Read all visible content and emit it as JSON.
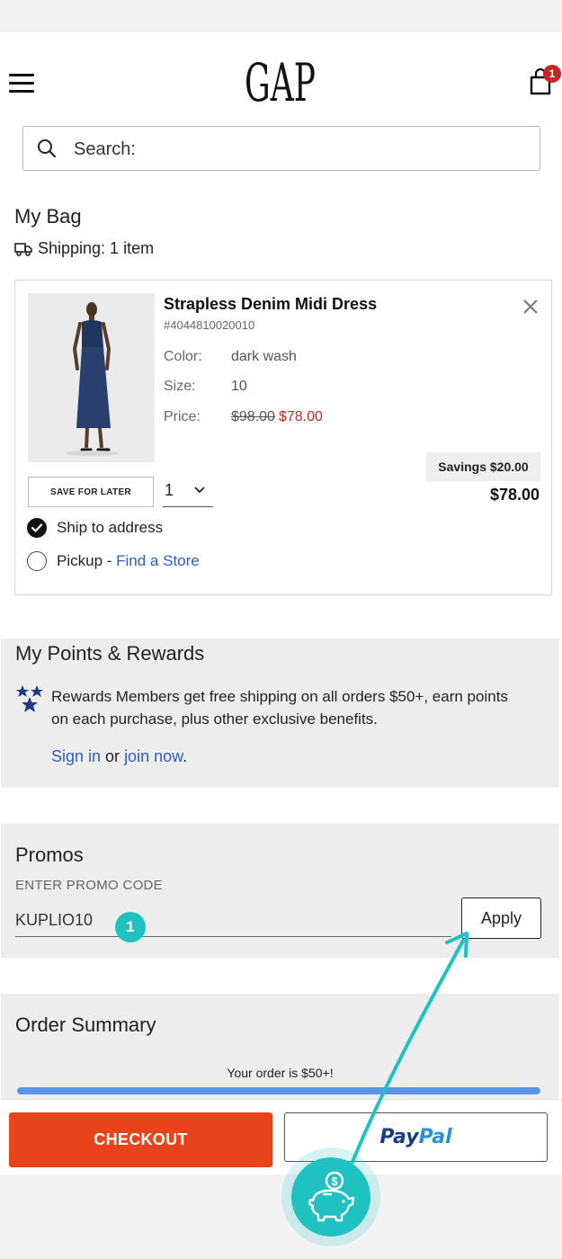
{
  "header": {
    "logo_text": "GAP",
    "bag_count": "1"
  },
  "search": {
    "placeholder": "Search:"
  },
  "bag": {
    "title": "My Bag",
    "shipping": "Shipping: 1 item"
  },
  "product": {
    "name": "Strapless Denim Midi Dress",
    "sku": "#4044810020010",
    "color_label": "Color:",
    "color_value": "dark wash",
    "size_label": "Size:",
    "size_value": "10",
    "price_label": "Price:",
    "price_original": "$98.00",
    "price_sale": "$78.00",
    "savings": "Savings $20.00",
    "total": "$78.00",
    "save_for_later": "SAVE FOR LATER",
    "quantity": "1",
    "ship_to_address": "Ship to address",
    "pickup": "Pickup - ",
    "find_store": "Find a Store"
  },
  "rewards": {
    "title": "My Points & Rewards",
    "text": "Rewards Members get free shipping on all orders $50+, earn points on each purchase, plus other exclusive benefits.",
    "sign_in": "Sign in",
    "or": " or ",
    "join_now": "join now",
    "period": "."
  },
  "promos": {
    "title": "Promos",
    "label": "ENTER PROMO CODE",
    "code": "KUPLIO10",
    "apply": "Apply",
    "step": "1"
  },
  "summary": {
    "title": "Order Summary",
    "message": "Your order is $50+!",
    "progress": 1.0
  },
  "checkout": {
    "checkout_label": "CHECKOUT",
    "paypal_a": "Pay",
    "paypal_b": "Pal"
  },
  "colors": {
    "accent_teal": "#1fc2c0",
    "checkout_orange": "#e8441b",
    "sale_red": "#c62828",
    "link_blue": "#2f5fbd"
  }
}
